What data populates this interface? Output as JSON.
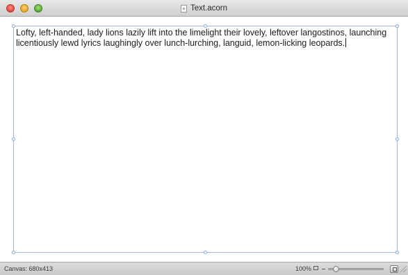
{
  "window": {
    "title": "Text.acorn",
    "icons": {
      "close": "close-icon",
      "minimize": "minimize-icon",
      "zoom": "zoom-icon",
      "document": "document-icon"
    }
  },
  "canvas": {
    "text": "Lofty, left-handed, lady lions lazily lift into the limelight their lovely, leftover langostinos, launching licentiously lewd lyrics laughingly over lunch-lurching, languid, lemon-licking leopards."
  },
  "statusbar": {
    "canvas_size": "Canvas: 680x413",
    "zoom": "100%",
    "zoom_slider_value": 0.1
  },
  "colors": {
    "selection_border": "#9db6e6",
    "text": "#1a1a1a"
  }
}
